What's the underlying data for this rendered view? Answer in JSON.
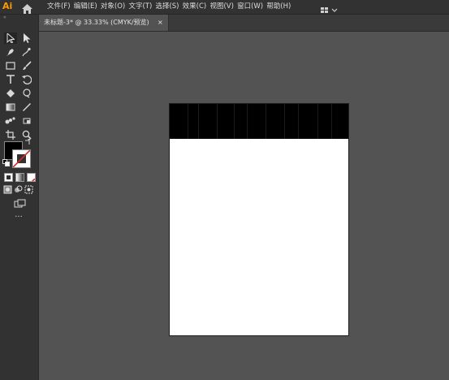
{
  "app": {
    "logo_text": "Ai"
  },
  "menu": {
    "items": [
      "文件(F)",
      "编辑(E)",
      "对象(O)",
      "文字(T)",
      "选择(S)",
      "效果(C)",
      "视图(V)",
      "窗口(W)",
      "帮助(H)"
    ]
  },
  "tabs": [
    {
      "label": "未标题-3* @ 33.33% (CMYK/预览)",
      "close": "×"
    }
  ],
  "toolbar": {
    "collapse": "«",
    "more_tools": "···"
  },
  "colors": {
    "accent": "#ff9a00",
    "chrome": "#323232",
    "canvas": "#535353",
    "artboard": "#ffffff",
    "band": "#000000",
    "fill": "#000000",
    "stroke": "#ffffff",
    "none_slash": "#e02424"
  }
}
